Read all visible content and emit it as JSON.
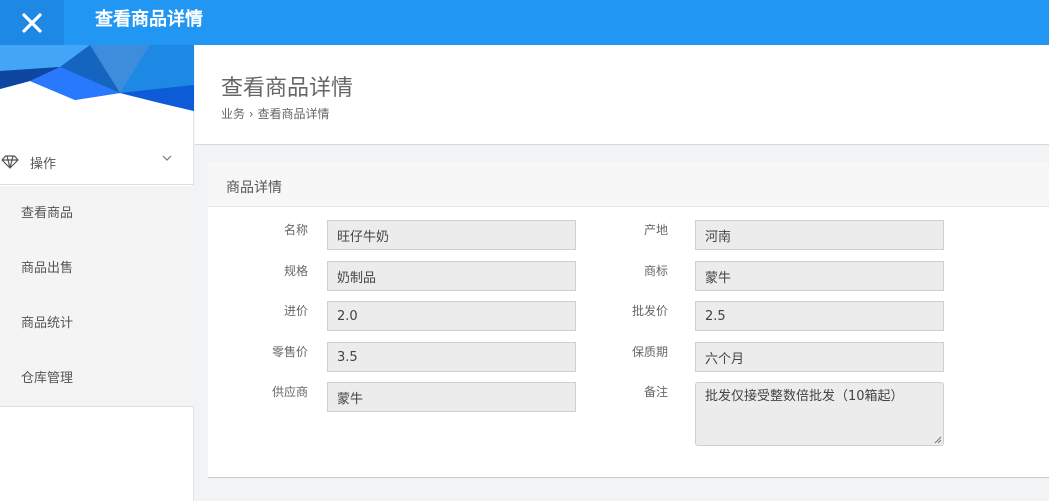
{
  "app": {
    "title": "查看商品详情"
  },
  "sidebar": {
    "menu_group": {
      "label": "操作"
    },
    "items": [
      {
        "label": "查看商品"
      },
      {
        "label": "商品出售"
      },
      {
        "label": "商品统计"
      },
      {
        "label": "仓库管理"
      }
    ]
  },
  "header": {
    "title": "查看商品详情",
    "breadcrumb": {
      "parent": "业务",
      "separator": "›",
      "current": "查看商品详情"
    }
  },
  "card": {
    "title": "商品详情"
  },
  "fields": {
    "name": {
      "label": "名称",
      "value": "旺仔牛奶"
    },
    "origin": {
      "label": "产地",
      "value": "河南"
    },
    "spec": {
      "label": "规格",
      "value": "奶制品"
    },
    "brand": {
      "label": "商标",
      "value": "蒙牛"
    },
    "purchase_price": {
      "label": "进价",
      "value": "2.0"
    },
    "wholesale_price": {
      "label": "批发价",
      "value": "2.5"
    },
    "retail_price": {
      "label": "零售价",
      "value": "3.5"
    },
    "shelf_life": {
      "label": "保质期",
      "value": "六个月"
    },
    "supplier": {
      "label": "供应商",
      "value": "蒙牛"
    },
    "remark": {
      "label": "备注",
      "value": "批发仅接受整数倍批发（10箱起）"
    }
  },
  "colors": {
    "topbar": "#2196f3",
    "close_bg": "#1e88e5",
    "banner": "#1a73e8"
  }
}
